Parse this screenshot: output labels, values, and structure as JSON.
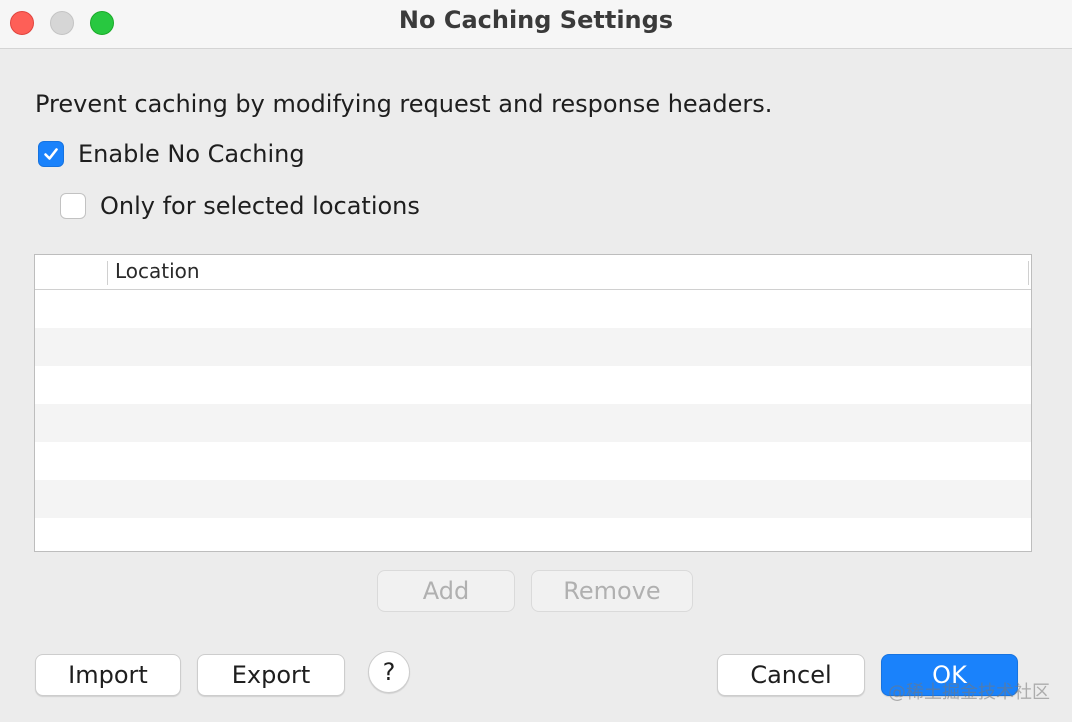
{
  "window": {
    "title": "No Caching Settings"
  },
  "description": "Prevent caching by modifying request and response headers.",
  "options": {
    "enable_no_caching": {
      "label": "Enable No Caching",
      "checked": true
    },
    "only_selected_locations": {
      "label": "Only for selected locations",
      "checked": false
    }
  },
  "table": {
    "columns": [
      "Location"
    ],
    "rows": []
  },
  "buttons": {
    "add": "Add",
    "remove": "Remove",
    "import": "Import",
    "export": "Export",
    "help": "?",
    "cancel": "Cancel",
    "ok": "OK"
  },
  "colors": {
    "accent": "#1a82fb",
    "close": "#fe5f57",
    "maximize": "#28c840"
  },
  "watermark": "@稀土掘金技术社区"
}
